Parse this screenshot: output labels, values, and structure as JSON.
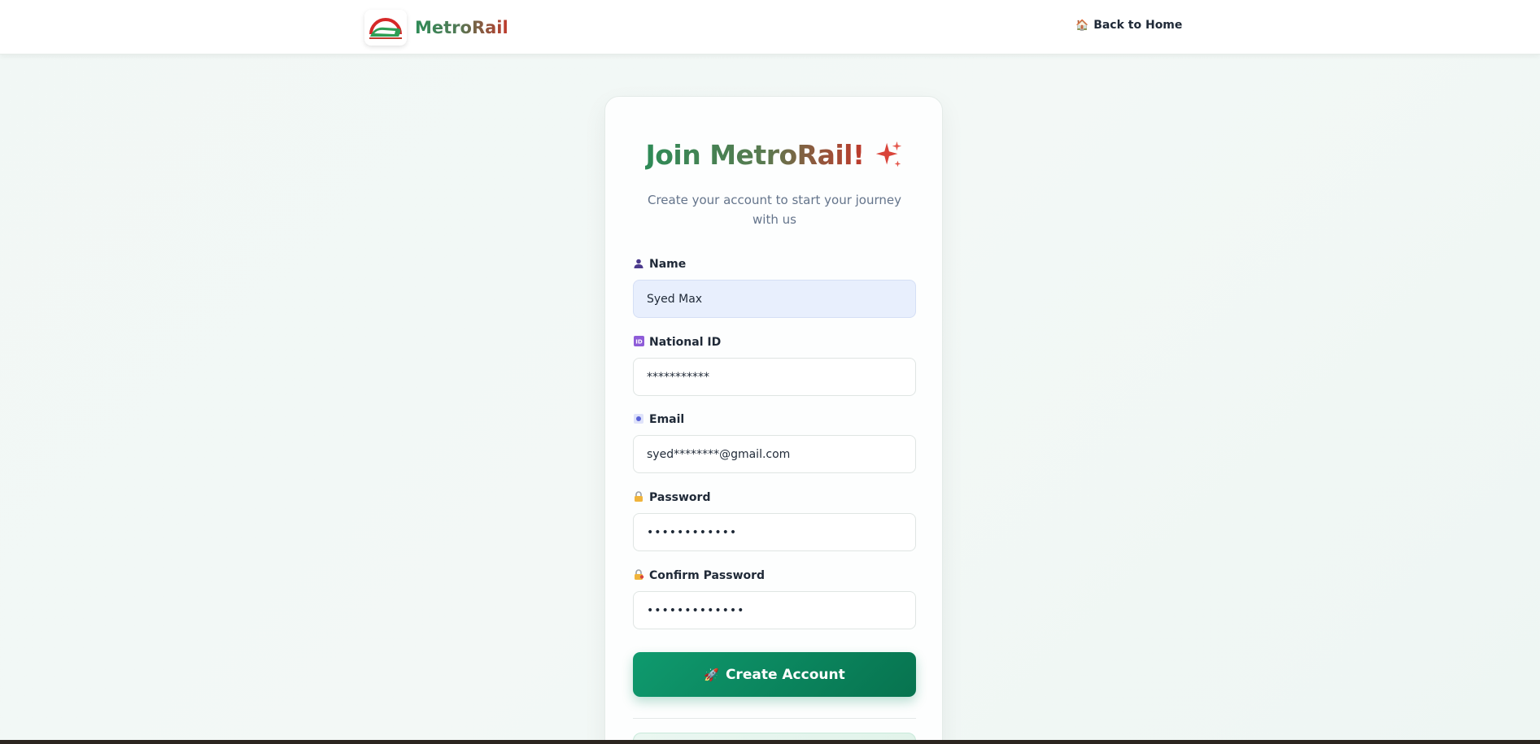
{
  "navbar": {
    "brand_name": "MetroRail",
    "back_label": "Back to Home",
    "back_icon": "house-icon"
  },
  "signup": {
    "title": "Join MetroRail!",
    "title_icon": "sparkle-icon",
    "subtitle": "Create your account to start your journey with us",
    "fields": [
      {
        "label": "Name",
        "icon": "person-icon",
        "value": "Syed Max"
      },
      {
        "label": "National ID",
        "icon": "id-icon",
        "value": "***********"
      },
      {
        "label": "Email",
        "icon": "email-icon",
        "value": "syed********@gmail.com"
      },
      {
        "label": "Password",
        "icon": "lock-icon",
        "value": "••••••••••••"
      },
      {
        "label": "Confirm Password",
        "icon": "lock-key-icon",
        "value": "•••••••••••••"
      }
    ],
    "submit_label": "Create Account",
    "submit_icon": "rocket-icon"
  },
  "colors": {
    "brand_green": "#2e8b57",
    "brand_red": "#c0392b",
    "button_green": "#0f9a6e",
    "filled_input_bg": "#e8effd"
  }
}
